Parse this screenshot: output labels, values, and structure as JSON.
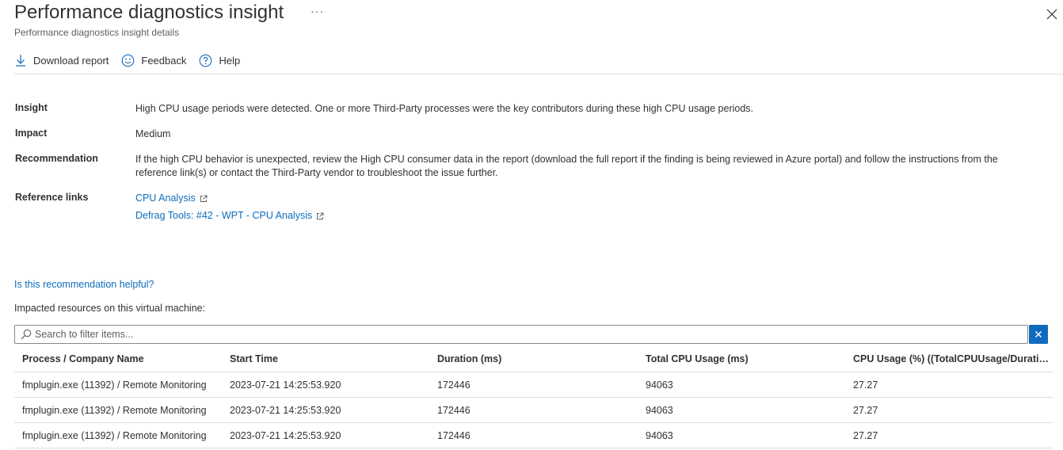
{
  "header": {
    "title": "Performance diagnostics insight",
    "more_label": "···",
    "subtitle": "Performance diagnostics insight details"
  },
  "toolbar": {
    "download_label": "Download report",
    "feedback_label": "Feedback",
    "help_label": "Help"
  },
  "details": {
    "insight_label": "Insight",
    "insight_value": "High CPU usage periods were detected. One or more Third-Party processes were the key contributors during these high CPU usage periods.",
    "impact_label": "Impact",
    "impact_value": "Medium",
    "recommendation_label": "Recommendation",
    "recommendation_value": "If the high CPU behavior is unexpected, review the High CPU consumer data in the report (download the full report if the finding is being reviewed in Azure portal) and follow the instructions from the reference link(s) or contact the Third-Party vendor to troubleshoot the issue further.",
    "reference_label": "Reference links",
    "links": [
      "CPU Analysis",
      "Defrag Tools: #42 - WPT - CPU Analysis"
    ]
  },
  "helpful_link": "Is this recommendation helpful?",
  "impacted_label": "Impacted resources on this virtual machine:",
  "search": {
    "placeholder": "Search to filter items..."
  },
  "table": {
    "columns": [
      "Process / Company Name",
      "Start Time",
      "Duration (ms)",
      "Total CPU Usage (ms)",
      "CPU Usage (%) ((TotalCPUUsage/Duratio..."
    ],
    "rows": [
      [
        "fmplugin.exe (11392) / Remote Monitoring",
        "2023-07-21 14:25:53.920",
        "172446",
        "94063",
        "27.27"
      ],
      [
        "fmplugin.exe (11392) / Remote Monitoring",
        "2023-07-21 14:25:53.920",
        "172446",
        "94063",
        "27.27"
      ],
      [
        "fmplugin.exe (11392) / Remote Monitoring",
        "2023-07-21 14:25:53.920",
        "172446",
        "94063",
        "27.27"
      ]
    ]
  },
  "colors": {
    "accent": "#0f6cbd",
    "text": "#323130",
    "border": "#e1dfdd"
  }
}
